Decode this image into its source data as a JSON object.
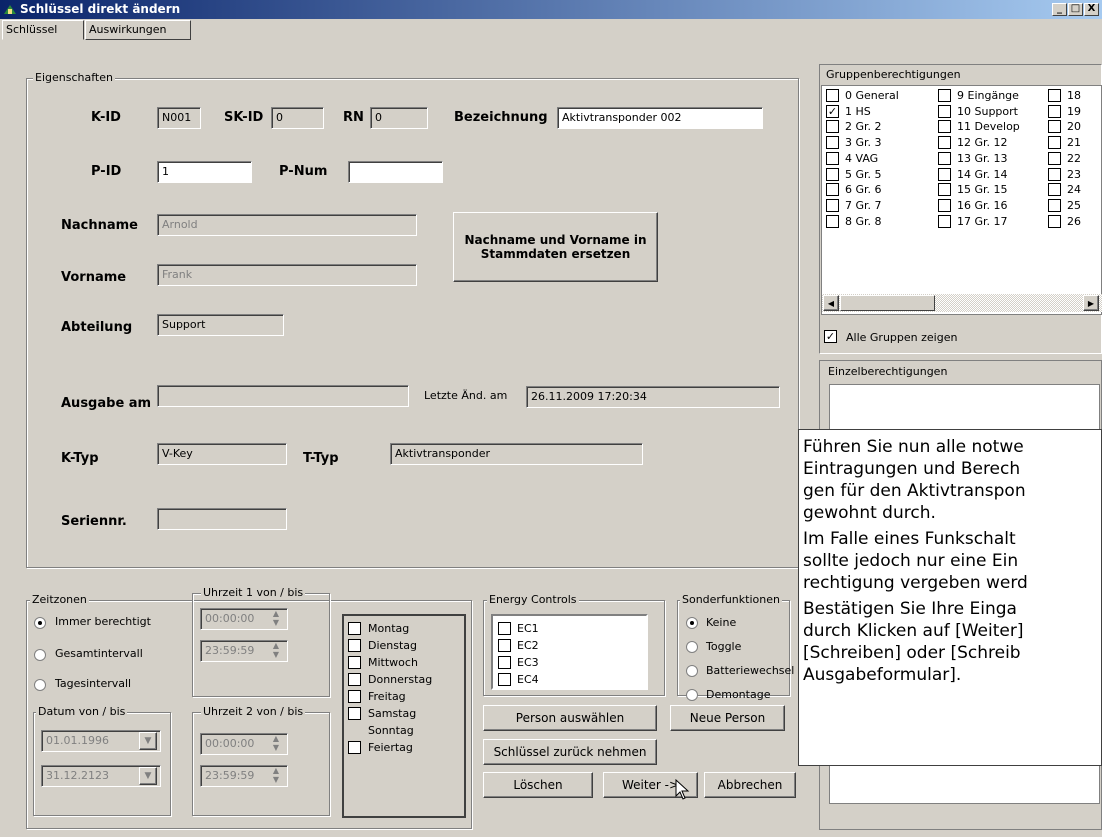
{
  "window": {
    "title": "Schlüssel direkt ändern",
    "min": "_",
    "max": "□",
    "close": "X"
  },
  "tabs": [
    "Schlüssel",
    "Auswirkungen"
  ],
  "eigenschaften": {
    "legend": "Eigenschaften",
    "kid_label": "K-ID",
    "kid": "N001",
    "skid_label": "SK-ID",
    "skid": "0",
    "rn_label": "RN",
    "rn": "0",
    "bez_label": "Bezeichnung",
    "bez": "Aktivtransponder 002",
    "pid_label": "P-ID",
    "pid": "1",
    "pnum_label": "P-Num",
    "pnum": "",
    "nachname_label": "Nachname",
    "nachname": "Arnold",
    "vorname_label": "Vorname",
    "vorname": "Frank",
    "replace_button": "Nachname und Vorname in Stammdaten ersetzen",
    "abteilung_label": "Abteilung",
    "abteilung": "Support",
    "ausgabe_label": "Ausgabe am",
    "ausgabe": "",
    "letzte_label": "Letzte Änd. am",
    "letzte": "26.11.2009 17:20:34",
    "ktyp_label": "K-Typ",
    "ktyp": "V-Key",
    "ttyp_label": "T-Typ",
    "ttyp": "Aktivtransponder",
    "serien_label": "Seriennr.",
    "serien": ""
  },
  "zeitzonen": {
    "legend": "Zeitzonen",
    "radios": [
      "Immer berechtigt",
      "Gesamtintervall",
      "Tagesintervall"
    ],
    "uhrzeit1_legend": "Uhrzeit 1 von / bis",
    "u1_von": "00:00:00",
    "u1_bis": "23:59:59",
    "uhrzeit2_legend": "Uhrzeit 2 von / bis",
    "u2_von": "00:00:00",
    "u2_bis": "23:59:59",
    "datum_legend": "Datum von / bis",
    "datum_von": "01.01.1996",
    "datum_bis": "31.12.2123",
    "days": [
      "Montag",
      "Dienstag",
      "Mittwoch",
      "Donnerstag",
      "Freitag",
      "Samstag",
      "Sonntag",
      "Feiertag"
    ]
  },
  "energy": {
    "legend": "Energy Controls",
    "items": [
      "EC1",
      "EC2",
      "EC3",
      "EC4"
    ]
  },
  "sonder": {
    "legend": "Sonderfunktionen",
    "items": [
      "Keine",
      "Toggle",
      "Batteriewechsel",
      "Demontage"
    ]
  },
  "buttons": {
    "person_waehlen": "Person auswählen",
    "neue_person": "Neue Person",
    "zurueck": "Schlüssel zurück nehmen",
    "loeschen": "Löschen",
    "weiter": "Weiter ->",
    "abbrechen": "Abbrechen"
  },
  "gruppen": {
    "legend": "Gruppenberechtigungen",
    "col1": [
      "0 General",
      "1 HS",
      "2 Gr. 2",
      "3 Gr. 3",
      "4 VAG",
      "5 Gr. 5",
      "6 Gr. 6",
      "7 Gr. 7",
      "8 Gr. 8"
    ],
    "col2": [
      "9 Eingänge",
      "10 Support",
      "11 Develop",
      "12 Gr. 12",
      "13 Gr. 13",
      "14 Gr. 14",
      "15 Gr. 15",
      "16 Gr. 16",
      "17 Gr. 17"
    ],
    "col3": [
      "18",
      "19",
      "20",
      "21",
      "22",
      "23",
      "24",
      "25",
      "26"
    ],
    "alle": "Alle Gruppen zeigen"
  },
  "einzel": {
    "legend": "Einzelberechtigungen"
  },
  "tooltip": {
    "lines": [
      "Führen Sie nun alle notwe",
      "Eintragungen und Berech",
      "gen für den Aktivtranspon",
      "gewohnt durch.",
      "Im Falle eines Funkschalt",
      "sollte jedoch nur eine Ein",
      "rechtigung vergeben werd",
      "Bestätigen Sie Ihre Einga",
      "durch Klicken auf [Weiter]",
      "[Schreiben] oder [Schreib",
      "Ausgabeformular]."
    ]
  }
}
